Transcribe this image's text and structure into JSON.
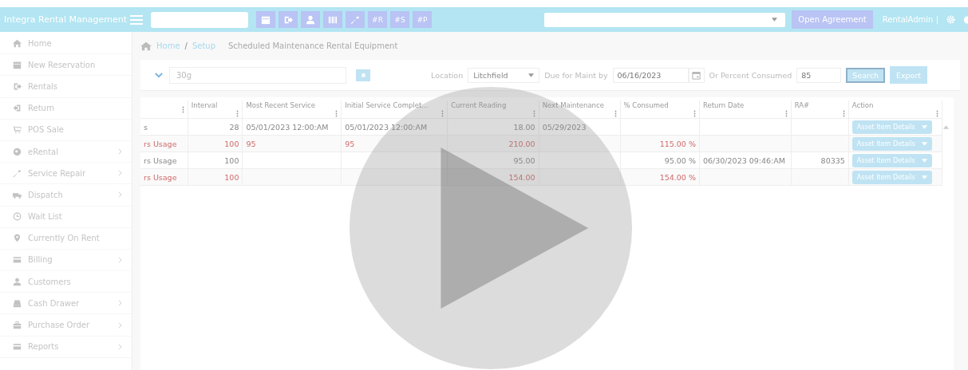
{
  "header": {
    "app_title": "Integra Rental Management",
    "quick_buttons": [
      "#R",
      "#S",
      "#P"
    ],
    "open_button": "Open Agreement",
    "user": "RentalAdmin |"
  },
  "sidebar": {
    "items": [
      {
        "label": "Home",
        "has_submenu": false
      },
      {
        "label": "New Reservation",
        "has_submenu": false
      },
      {
        "label": "Rentals",
        "has_submenu": false
      },
      {
        "label": "Return",
        "has_submenu": false
      },
      {
        "label": "POS Sale",
        "has_submenu": false
      },
      {
        "label": "eRental",
        "has_submenu": true
      },
      {
        "label": "Service Repair",
        "has_submenu": true
      },
      {
        "label": "Dispatch",
        "has_submenu": true
      },
      {
        "label": "Wait List",
        "has_submenu": false
      },
      {
        "label": "Currently On Rent",
        "has_submenu": false
      },
      {
        "label": "Billing",
        "has_submenu": true
      },
      {
        "label": "Customers",
        "has_submenu": false
      },
      {
        "label": "Cash Drawer",
        "has_submenu": true
      },
      {
        "label": "Purchase Order",
        "has_submenu": true
      },
      {
        "label": "Reports",
        "has_submenu": true
      }
    ]
  },
  "breadcrumb": {
    "items": [
      "Home",
      "Setup"
    ],
    "separator": "/",
    "page_title": "Scheduled Maintenance Rental Equipment"
  },
  "filters": {
    "search_value": "30g",
    "location_label": "Location",
    "location_value": "Litchfield",
    "due_label": "Due for Maint by",
    "due_value": "06/16/2023",
    "percent_label": "Or Percent Consumed",
    "percent_value": "85",
    "search_button": "Search",
    "export_button": "Export"
  },
  "table": {
    "columns": [
      "",
      "Interval",
      "Most Recent Service",
      "Initial Service Complet...",
      "Current Reading",
      "Next Maintenance",
      "% Consumed",
      "Return Date",
      "RA#",
      "Action"
    ],
    "rows": [
      {
        "overdue": false,
        "cells": [
          "s",
          "28",
          "05/01/2023 12:00:AM",
          "05/01/2023 12:00:AM",
          "18.00",
          "05/29/2023",
          "",
          "",
          "",
          "Asset Item Details"
        ]
      },
      {
        "overdue": true,
        "cells": [
          "rs Usage",
          "100",
          "95",
          "95",
          "210.00",
          "",
          "115.00 %",
          "",
          "",
          "Asset Item Details"
        ]
      },
      {
        "overdue": false,
        "cells": [
          "rs Usage",
          "100",
          "",
          "",
          "95.00",
          "",
          "95.00 %",
          "06/30/2023 09:46:AM",
          "80335",
          "Asset Item Details"
        ]
      },
      {
        "overdue": true,
        "cells": [
          "rs Usage",
          "100",
          "",
          "",
          "154.00",
          "",
          "154.00 %",
          "",
          "",
          "Asset Item Details"
        ]
      }
    ]
  }
}
